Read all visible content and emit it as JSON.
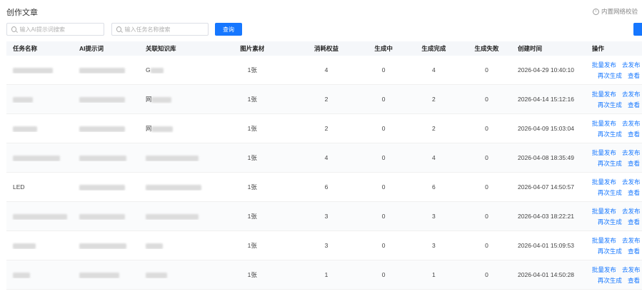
{
  "page": {
    "title": "创作文章",
    "hint": "内置网络校验"
  },
  "search": {
    "prompt_placeholder": "输入AI提示词搜索",
    "task_placeholder": "输入任务名称搜索",
    "query_label": "查询"
  },
  "table": {
    "headers": [
      "任务名称",
      "AI提示词",
      "关联知识库",
      "图片素材",
      "消耗权益",
      "生成中",
      "生成完成",
      "生成失败",
      "创建时间",
      "操作"
    ],
    "rows": [
      {
        "name": "",
        "prompt": "",
        "kb": "G",
        "img": "1张",
        "quota": "4",
        "ing": "0",
        "done": "4",
        "fail": "0",
        "time": "2026-04-29 10:40:10"
      },
      {
        "name": "",
        "prompt": "",
        "kb": "网",
        "img": "1张",
        "quota": "2",
        "ing": "0",
        "done": "2",
        "fail": "0",
        "time": "2026-04-14 15:12:16"
      },
      {
        "name": "",
        "prompt": "",
        "kb": "网",
        "img": "1张",
        "quota": "2",
        "ing": "0",
        "done": "2",
        "fail": "0",
        "time": "2026-04-09 15:03:04"
      },
      {
        "name": "",
        "prompt": "",
        "kb": "",
        "img": "1张",
        "quota": "4",
        "ing": "0",
        "done": "4",
        "fail": "0",
        "time": "2026-04-08 18:35:49"
      },
      {
        "name": "LED",
        "prompt": "",
        "kb": "",
        "img": "1张",
        "quota": "6",
        "ing": "0",
        "done": "6",
        "fail": "0",
        "time": "2026-04-07 14:50:57"
      },
      {
        "name": "",
        "prompt": "",
        "kb": "",
        "img": "1张",
        "quota": "3",
        "ing": "0",
        "done": "3",
        "fail": "0",
        "time": "2026-04-03 18:22:21"
      },
      {
        "name": "",
        "prompt": "",
        "kb": "",
        "img": "1张",
        "quota": "3",
        "ing": "0",
        "done": "3",
        "fail": "0",
        "time": "2026-04-01 15:09:53"
      },
      {
        "name": "",
        "prompt": "",
        "kb": "",
        "img": "1张",
        "quota": "1",
        "ing": "0",
        "done": "1",
        "fail": "0",
        "time": "2026-04-01 14:50:28"
      }
    ],
    "ops": {
      "batch": "批量发布",
      "publish": "去发布",
      "regen": "再次生成",
      "view": "查看"
    }
  }
}
